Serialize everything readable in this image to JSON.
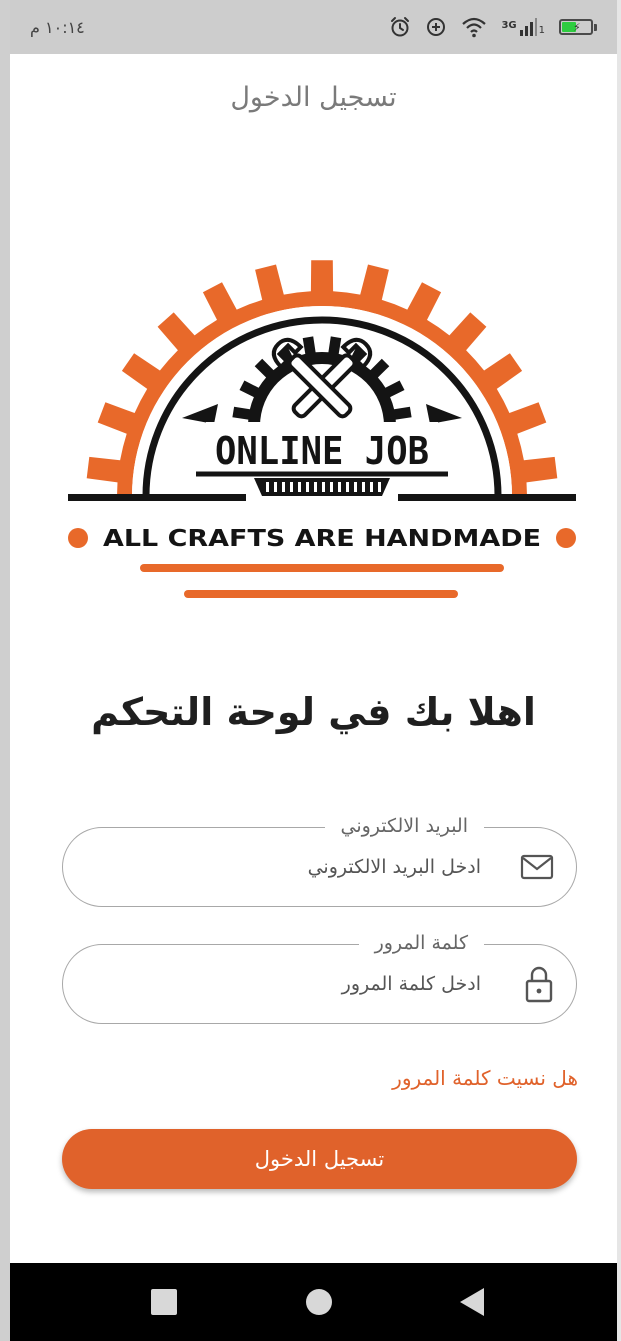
{
  "status_bar": {
    "time": "١٠:١٤ م",
    "network": "3G",
    "sim_slot": "1"
  },
  "header": {
    "title": "تسجيل الدخول"
  },
  "logo": {
    "brand": "ONLINE JOB",
    "tagline": "ALL CRAFTS ARE HANDMADE"
  },
  "welcome": "اهلا بك في لوحة التحكم",
  "email": {
    "label": "البريد الالكتروني",
    "placeholder": "ادخل البريد الالكتروني",
    "icon": "mail-icon"
  },
  "password": {
    "label": "كلمة المرور",
    "placeholder": "ادخل كلمة المرور",
    "icon": "lock-icon"
  },
  "forgot_password": "هل نسيت كلمة المرور",
  "login_button": "تسجيل الدخول",
  "colors": {
    "accent": "#e0622b",
    "logo_orange": "#e8692a"
  }
}
